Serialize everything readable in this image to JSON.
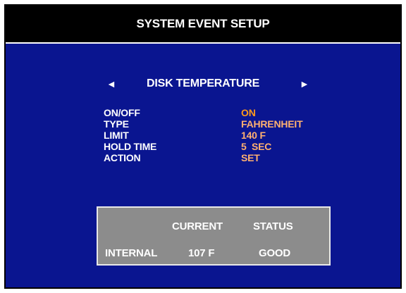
{
  "title": "SYSTEM EVENT  SETUP",
  "event_selector": {
    "left_arrow": "◄",
    "right_arrow": "►",
    "selected_event": "DISK TEMPERATURE"
  },
  "settings": [
    {
      "label": "ON/OFF",
      "value": "ON"
    },
    {
      "label": "TYPE",
      "value": "FAHRENHEIT"
    },
    {
      "label": "LIMIT",
      "value": "140 F"
    },
    {
      "label": "HOLD TIME",
      "value": "5  SEC"
    },
    {
      "label": "ACTION",
      "value": "SET"
    }
  ],
  "status_table": {
    "headers": {
      "current": "CURRENT",
      "status": "STATUS"
    },
    "rows": [
      {
        "name": "INTERNAL",
        "current": "107 F",
        "status": "GOOD"
      }
    ]
  },
  "colors": {
    "background": "#0a1590",
    "title_bar": "#000000",
    "value_text": "#ffb070",
    "status_box": "#8c8c8c"
  }
}
